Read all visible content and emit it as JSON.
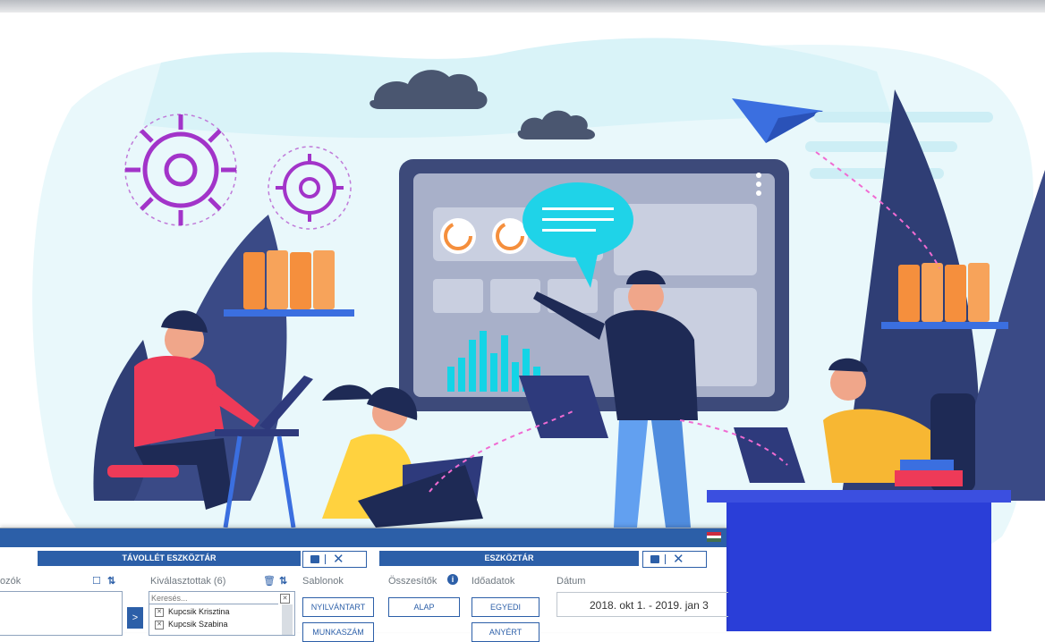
{
  "toolbar_left": {
    "title": "TÁVOLLÉT ESZKÖZTÁR"
  },
  "toolbar_right": {
    "title": "ESZKÖZTÁR"
  },
  "columns": {
    "col1_label": "ozók",
    "selected_label": "Kiválasztottak (6)",
    "templates_label": "Sablonok",
    "summaries_label": "Összesítők",
    "timedata_label": "Időadatok",
    "date_label": "Dátum"
  },
  "search": {
    "placeholder": "Keresés..."
  },
  "selected_items": [
    "Kupcsik Krisztina",
    "Kupcsik Szabina"
  ],
  "buttons": {
    "templates_1": "NYILVÁNTART",
    "templates_2": "MUNKASZÁM",
    "summaries_1": "ALAP",
    "timedata_1": "EGYEDI",
    "timedata_2": "ANYÉRT"
  },
  "date_range": "2018. okt 1.  -  2019. jan 3",
  "colors": {
    "accent": "#2c5fa8",
    "background": "#ffffff"
  }
}
